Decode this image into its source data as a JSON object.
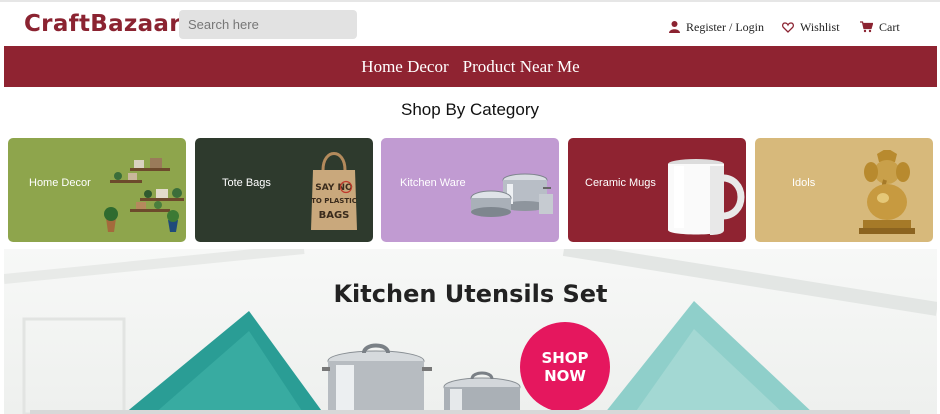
{
  "header": {
    "logo": "CraftBazaar",
    "search_placeholder": "Search here",
    "register_login": "Register / Login",
    "wishlist": "Wishlist",
    "cart": "Cart"
  },
  "menu": {
    "items": [
      "Home Decor",
      "Product Near Me"
    ]
  },
  "shop_by_category": {
    "title": "Shop By Category",
    "cards": [
      {
        "label": "Home Decor",
        "color": "#8ea54c",
        "icon": "shelf-decor-icon"
      },
      {
        "label": "Tote Bags",
        "color": "#2e3a2d",
        "icon": "tote-bag-icon",
        "bag_text": "SAY NO TO PLASTIC BAGS"
      },
      {
        "label": "Kitchen Ware",
        "color": "#c19bd2",
        "icon": "cookware-icon"
      },
      {
        "label": "Ceramic Mugs",
        "color": "#8f2331",
        "icon": "mug-icon"
      },
      {
        "label": "Idols",
        "color": "#d7b97b",
        "icon": "ganesha-idol-icon"
      }
    ]
  },
  "banner": {
    "title": "Kitchen Utensils Set",
    "cta": "SHOP NOW",
    "cta_color": "#e5175e"
  },
  "colors": {
    "brand": "#8b2331",
    "menu_bar": "#8f2331"
  }
}
